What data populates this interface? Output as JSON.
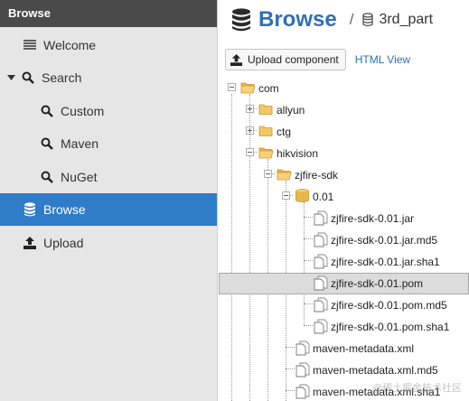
{
  "sidebar": {
    "header": "Browse",
    "items": [
      {
        "label": "Welcome",
        "icon": "list-icon",
        "active": false
      },
      {
        "label": "Search",
        "icon": "search-icon",
        "active": false
      },
      {
        "label": "Custom",
        "icon": "search-icon",
        "active": false
      },
      {
        "label": "Maven",
        "icon": "search-icon",
        "active": false
      },
      {
        "label": "NuGet",
        "icon": "search-icon",
        "active": false
      },
      {
        "label": "Browse",
        "icon": "database-icon",
        "active": true
      },
      {
        "label": "Upload",
        "icon": "upload-icon",
        "active": false
      }
    ]
  },
  "header": {
    "title": "Browse",
    "separator": "/",
    "repository": "3rd_part"
  },
  "toolbar": {
    "upload_label": "Upload component",
    "html_view_label": "HTML View"
  },
  "tree": {
    "nodes": [
      {
        "label": "com",
        "type": "folder-open",
        "toggle": "minus"
      },
      {
        "label": "allyun",
        "type": "folder",
        "toggle": "plus"
      },
      {
        "label": "ctg",
        "type": "folder",
        "toggle": "plus"
      },
      {
        "label": "hikvision",
        "type": "folder-open",
        "toggle": "minus"
      },
      {
        "label": "zjfire-sdk",
        "type": "folder-open",
        "toggle": "minus"
      },
      {
        "label": "0.01",
        "type": "component",
        "toggle": "minus"
      },
      {
        "label": "zjfire-sdk-0.01.jar",
        "type": "file"
      },
      {
        "label": "zjfire-sdk-0.01.jar.md5",
        "type": "file"
      },
      {
        "label": "zjfire-sdk-0.01.jar.sha1",
        "type": "file"
      },
      {
        "label": "zjfire-sdk-0.01.pom",
        "type": "file",
        "selected": true
      },
      {
        "label": "zjfire-sdk-0.01.pom.md5",
        "type": "file"
      },
      {
        "label": "zjfire-sdk-0.01.pom.sha1",
        "type": "file"
      },
      {
        "label": "maven-metadata.xml",
        "type": "file"
      },
      {
        "label": "maven-metadata.xml.md5",
        "type": "file"
      },
      {
        "label": "maven-metadata.xml.sha1",
        "type": "file"
      }
    ]
  },
  "watermark": "@稀土掘金技术社区",
  "colors": {
    "accent": "#2f7cc9",
    "sidebar_bg": "#e6e6e6",
    "header_bg": "#4a4a4a",
    "folder": "#f2c866"
  }
}
